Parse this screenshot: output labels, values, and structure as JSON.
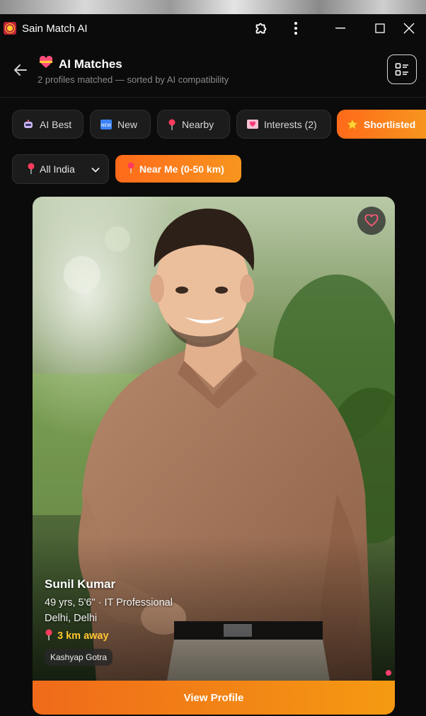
{
  "window": {
    "app_title": "Sain Match AI"
  },
  "header": {
    "title": "AI Matches",
    "subtitle": "2 profiles matched — sorted by AI compatibility"
  },
  "filters": {
    "chips": [
      {
        "label": "AI Best",
        "icon": "robot-icon",
        "active": false
      },
      {
        "label": "New",
        "icon": "new-badge-icon",
        "active": false
      },
      {
        "label": "Nearby",
        "icon": "pin-icon",
        "active": false
      },
      {
        "label": "Interests (2)",
        "icon": "heart-letter-icon",
        "active": false
      },
      {
        "label": "Shortlisted",
        "icon": "star-icon",
        "active": true
      }
    ],
    "region_select": {
      "value": "All India",
      "icon": "pin-icon"
    },
    "near_me": {
      "label": "Near Me (0-50 km)",
      "icon": "pin-icon"
    }
  },
  "profile": {
    "name": "Sunil Kumar",
    "details": "49 yrs, 5'6\" · IT Professional",
    "location": "Delhi, Delhi",
    "distance": "3 km away",
    "gotra": "Kashyap Gotra",
    "view_button": "View Profile"
  },
  "colors": {
    "accent_start": "#ff6a1a",
    "accent_end": "#f7951e",
    "distance": "#ffc530",
    "online": "#ff3d6e"
  }
}
